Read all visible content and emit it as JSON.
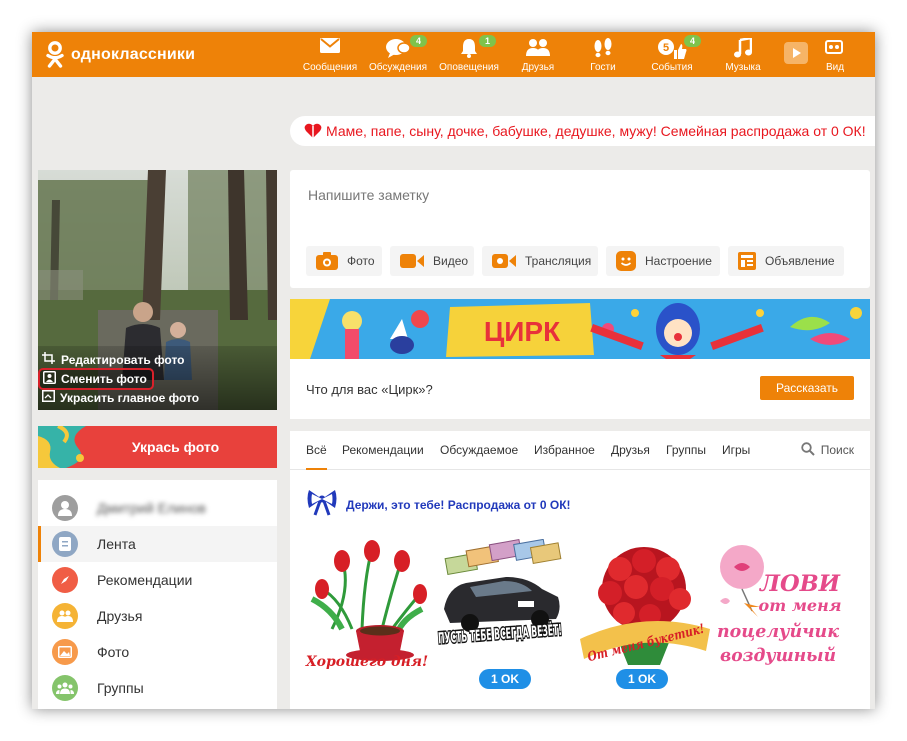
{
  "app": {
    "name": "одноклассники"
  },
  "nav": [
    {
      "label": "Сообщения",
      "icon": "envelope-icon",
      "badge": ""
    },
    {
      "label": "Обсуждения",
      "icon": "chat-bubbles-icon",
      "badge": "4"
    },
    {
      "label": "Оповещения",
      "icon": "bell-icon",
      "badge": "1"
    },
    {
      "label": "Друзья",
      "icon": "friends-icon",
      "badge": ""
    },
    {
      "label": "Гости",
      "icon": "footprints-icon",
      "badge": ""
    },
    {
      "label": "События",
      "icon": "thumbs-up-icon",
      "badge": "4",
      "count": "5"
    },
    {
      "label": "Музыка",
      "icon": "music-note-icon",
      "badge": ""
    },
    {
      "label": "Видео",
      "icon": "play-icon",
      "badge": "",
      "display": "Вид"
    }
  ],
  "promo": {
    "text": "Маме, папе, сыну, дочке, бабушке, дедушке, мужу! Семейная распродажа от 0 ОК!"
  },
  "photo_menu": {
    "edit": "Редактировать фото",
    "change": "Сменить фото",
    "decorate_main": "Украсить главное фото"
  },
  "decorate_button": "Укрась фото",
  "left_menu": {
    "user_name": "Дмитрий Елинов",
    "items": [
      {
        "label": "Лента",
        "color": "#8fa7c4",
        "icon": "feed-icon",
        "active": true
      },
      {
        "label": "Рекомендации",
        "color": "#f05d45",
        "icon": "compass-icon",
        "active": false
      },
      {
        "label": "Друзья",
        "color": "#f5b335",
        "icon": "friends-icon",
        "active": false
      },
      {
        "label": "Фото",
        "color": "#f79a4b",
        "icon": "photo-icon",
        "active": false
      },
      {
        "label": "Группы",
        "color": "#85c46b",
        "icon": "groups-icon",
        "active": false
      }
    ]
  },
  "note": {
    "placeholder": "Напишите заметку",
    "buttons": [
      "Фото",
      "Видео",
      "Трансляция",
      "Настроение",
      "Объявление"
    ]
  },
  "circus": {
    "banner_title": "ЦИРК",
    "question": "Что для вас «Цирк»?",
    "button": "Рассказать"
  },
  "feed": {
    "tabs": [
      "Всё",
      "Рекомендации",
      "Обсуждаемое",
      "Избранное",
      "Друзья",
      "Группы",
      "Игры"
    ],
    "search_label": "Поиск",
    "gift_banner": "Держи, это тебе! Распродажа от 0 ОК!",
    "gifts": [
      {
        "caption": "Хорошего дня!",
        "price": ""
      },
      {
        "caption": "ПУСТЬ ТЕБЕ ВСЕГДА ВЕЗЁТ!",
        "price": "1 OK"
      },
      {
        "caption": "От меня букетик!",
        "price": "1 OK"
      },
      {
        "caption": "ЛОВИ от меня поцелуйчик воздушный",
        "price": ""
      }
    ]
  },
  "colors": {
    "brand_orange": "#ee8208",
    "badge_green": "#7fc34b",
    "promo_red": "#e8171f",
    "link_blue": "#2139bb",
    "price_blue": "#1f8fe6"
  }
}
